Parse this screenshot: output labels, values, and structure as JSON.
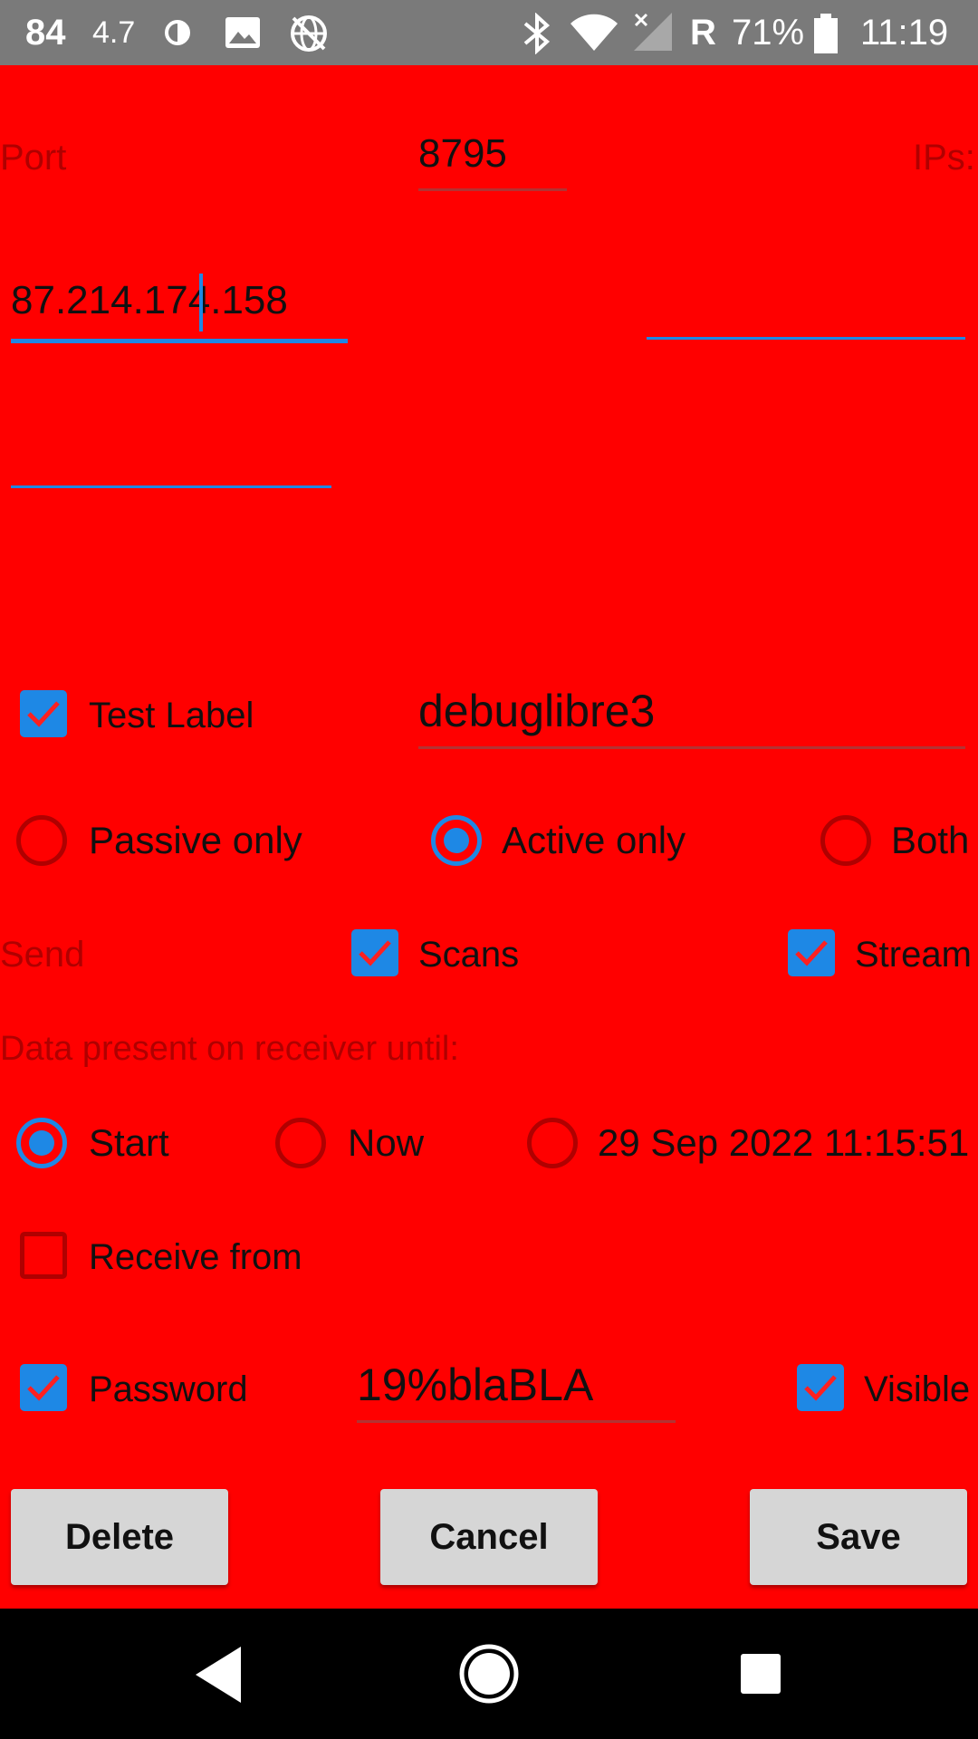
{
  "status_bar": {
    "left_num1": "84",
    "left_num2": "4.7",
    "roaming": "R",
    "battery": "71%",
    "time": "11:19",
    "icons": [
      "contrast-icon",
      "image-icon",
      "globe-off-icon",
      "bluetooth-icon",
      "wifi-icon",
      "signal-off-icon",
      "battery-icon"
    ]
  },
  "form": {
    "port_label": "Port",
    "port_value": "8795",
    "ips_label": "IPs:",
    "ip1_value": "87.214.174.158",
    "ip2_value": "",
    "ip3_value": "",
    "test_label": "Test Label",
    "test_label_checked": true,
    "label_value": "debuglibre3",
    "mode_options": [
      "Passive only",
      "Active only",
      "Both"
    ],
    "mode_selected": "Active only",
    "send_label": "Send",
    "send_scans": "Scans",
    "send_scans_checked": true,
    "send_stream": "Stream",
    "send_stream_checked": true,
    "data_present_label": "Data present on receiver until:",
    "until_options": [
      "Start",
      "Now",
      "29 Sep 2022 11:15:51"
    ],
    "until_selected": "Start",
    "receive_from": "Receive from",
    "receive_from_checked": false,
    "password_label": "Password",
    "password_checked": true,
    "password_value": "19%blaBLA",
    "visible_label": "Visible",
    "visible_checked": true
  },
  "buttons": {
    "delete": "Delete",
    "cancel": "Cancel",
    "save": "Save"
  },
  "colors": {
    "background": "#ff0000",
    "accent": "#1e88e5",
    "label": "#b00000"
  }
}
